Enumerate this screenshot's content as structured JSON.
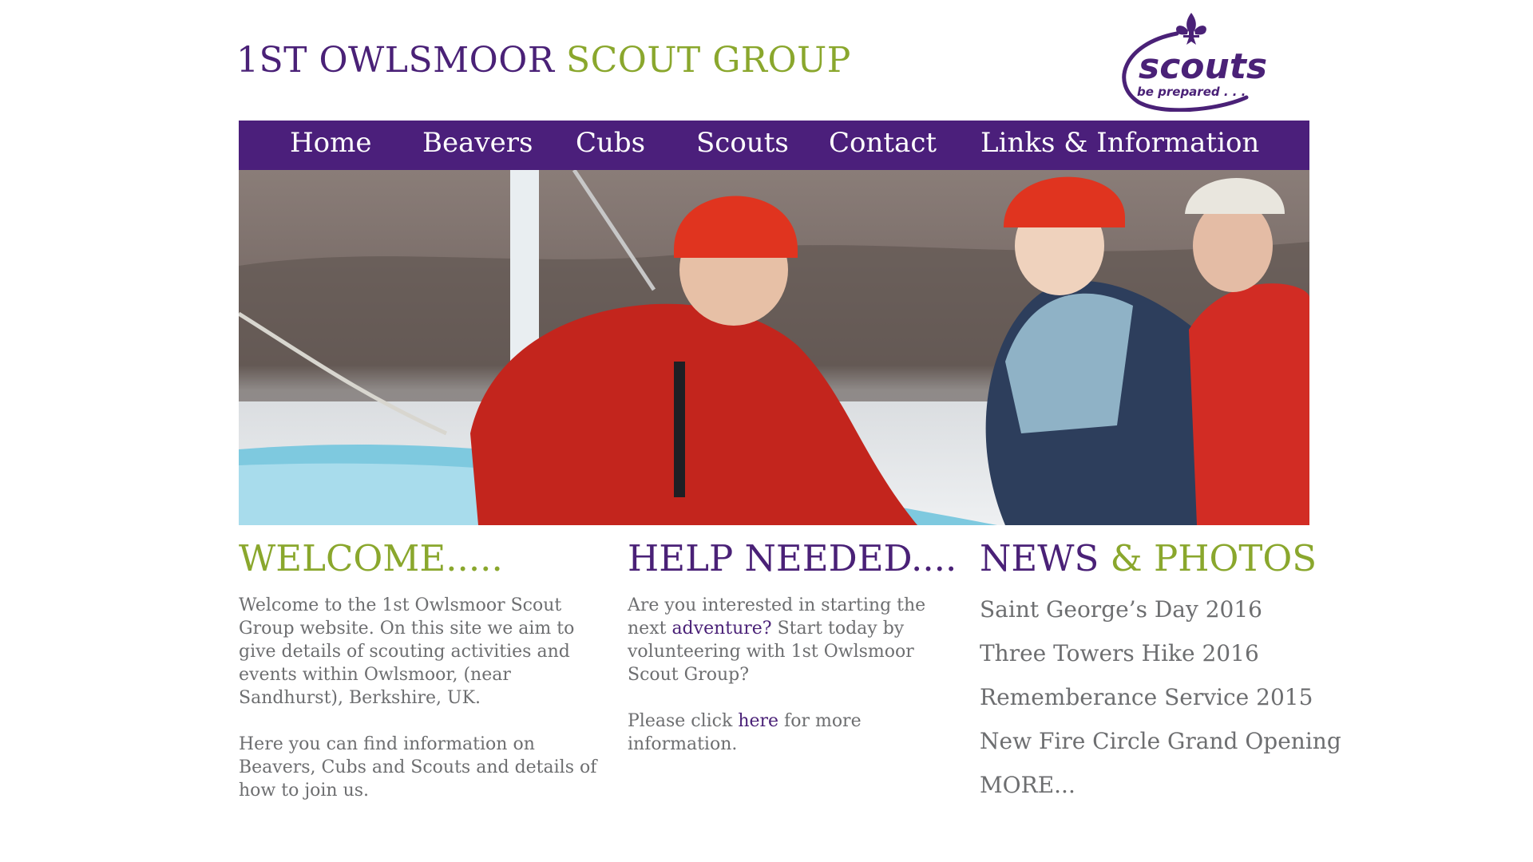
{
  "header": {
    "title_part1": "1ST OWLSMOOR",
    "title_part2": "SCOUT GROUP",
    "logo": {
      "icon": "fleur-de-lis-icon",
      "wordmark": "scouts",
      "tagline": "be prepared . . ."
    }
  },
  "nav": {
    "items": [
      {
        "label": "Home"
      },
      {
        "label": "Beavers"
      },
      {
        "label": "Cubs"
      },
      {
        "label": "Scouts"
      },
      {
        "label": "Contact"
      },
      {
        "label": "Links & Information"
      }
    ]
  },
  "welcome": {
    "heading": "WELCOME.....",
    "paragraph1": "Welcome to the 1st Owlsmoor Scout Group website. On this site we aim to give details of scouting  activities and events within Owlsmoor, (near Sandhurst), Berkshire, UK.",
    "paragraph2": " Here you can find information on Beavers, Cubs and Scouts and details of how to join us."
  },
  "help": {
    "heading": "HELP NEEDED....",
    "p1_before": "Are you interested in starting the next ",
    "p1_link": "adventure?",
    "p1_after": "  Start today by volunteering with 1st Owlsmoor Scout Group?",
    "p2_before": "Please click ",
    "p2_link": "here",
    "p2_after": " for more information."
  },
  "news": {
    "heading_part1": "NEWS",
    "heading_part2": "& PHOTOS",
    "items": [
      {
        "label": "Saint George’s Day 2016"
      },
      {
        "label": "Three Towers Hike 2016"
      },
      {
        "label": "Rememberance Service 2015"
      },
      {
        "label": "New Fire Circle Grand Opening"
      },
      {
        "label": "MORE..."
      }
    ]
  },
  "colors": {
    "brand_purple": "#4b1f7b",
    "brand_green": "#8aa72d",
    "body_text": "#6d6e70"
  }
}
